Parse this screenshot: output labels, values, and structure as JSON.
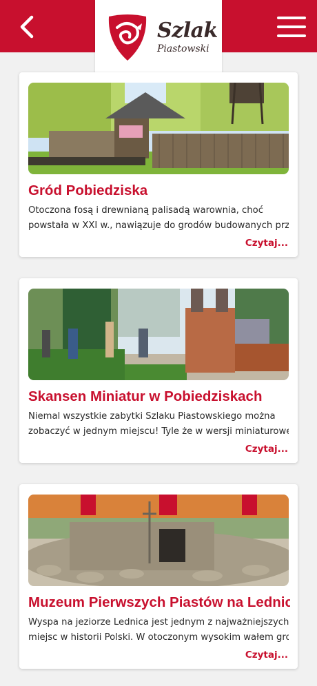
{
  "header": {
    "brand_line1": "Szlak",
    "brand_line2": "Piastowski",
    "brand_color": "#c8102e",
    "back_icon": "chevron-left-icon",
    "menu_icon": "hamburger-menu-icon"
  },
  "cards": [
    {
      "title": "Gród Pobiedziska",
      "description_lines": [
        "Otoczona fosą i drewnianą palisadą warownia, choć",
        "powstała w XXI w., nawiązuje do grodów budowanych prz"
      ],
      "more_label": "Czytaj..."
    },
    {
      "title": "Skansen Miniatur w Pobiedziskach",
      "description_lines": [
        "Niemal wszystkie zabytki Szlaku Piastowskiego można",
        "zobaczyć w jednym miejscu! Tyle że w wersji miniaturowe"
      ],
      "more_label": "Czytaj..."
    },
    {
      "title": "Muzeum Pierwszych Piastów na Lednicy",
      "description_lines": [
        "Wyspa na jeziorze Lednica jest jednym z najważniejszych",
        "miejsc w historii Polski. W otoczonym wysokim wałem gro"
      ],
      "more_label": "Czytaj..."
    }
  ]
}
